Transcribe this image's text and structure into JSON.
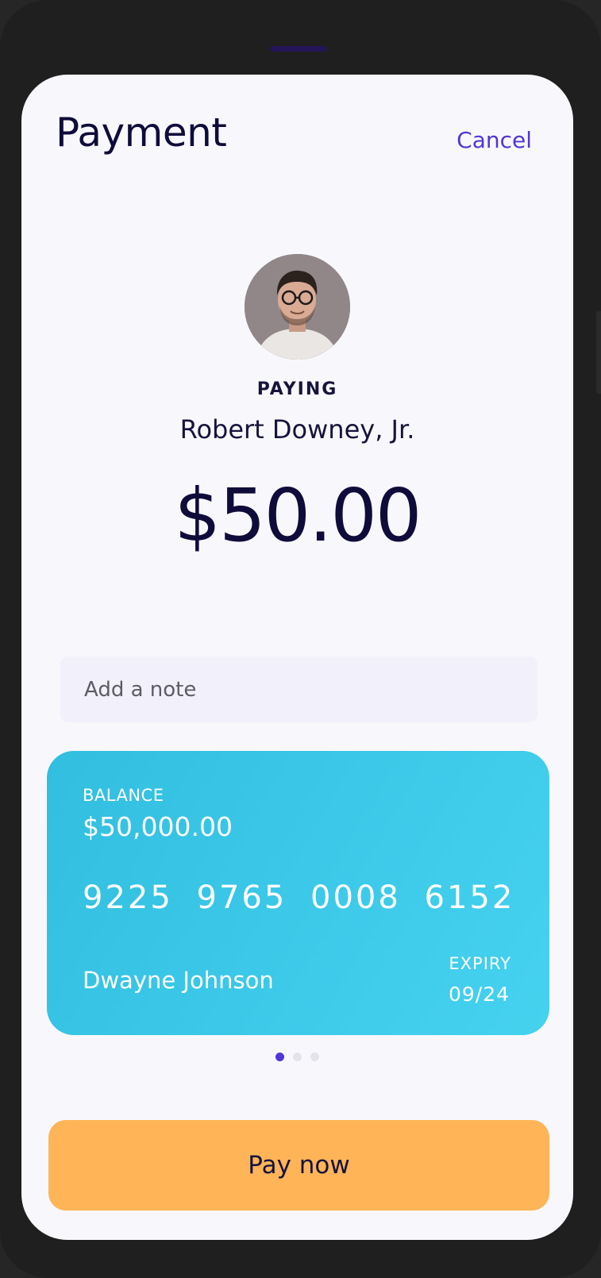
{
  "header": {
    "title": "Payment",
    "cancel_label": "Cancel"
  },
  "payee": {
    "paying_label": "PAYING",
    "name": "Robert Downey, Jr."
  },
  "amount": "$50.00",
  "note": {
    "placeholder": "Add a note",
    "value": ""
  },
  "card": {
    "balance_label": "BALANCE",
    "balance_value": "$50,000.00",
    "number": "9225 9765 0008 6152",
    "holder_name": "Dwayne Johnson",
    "expiry_label": "EXPIRY",
    "expiry_value": "09/24"
  },
  "pager": {
    "total": 3,
    "active_index": 0
  },
  "pay_button_label": "Pay now",
  "colors": {
    "accent": "#5136d8",
    "card": "#3cc8e8",
    "button": "#ffb457",
    "text_dark": "#0f0c3b"
  }
}
